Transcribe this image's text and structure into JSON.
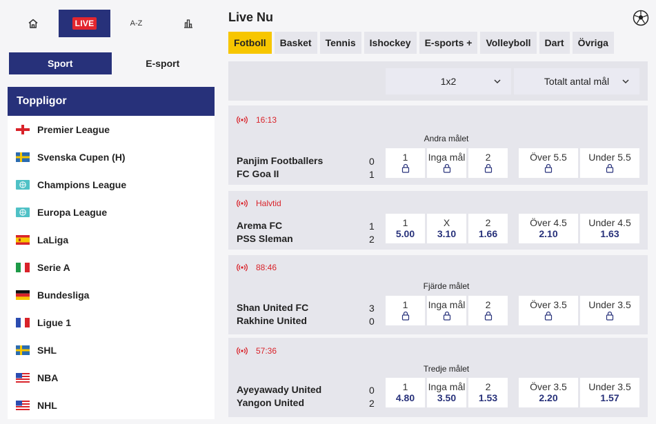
{
  "nav": {
    "home_icon": "home-icon",
    "live_label": "LIVE",
    "az_label": "A-Z",
    "stats_icon": "bar-chart-icon"
  },
  "segment": {
    "sport_label": "Sport",
    "esport_label": "E-sport"
  },
  "topleagues": {
    "title": "Toppligor",
    "items": [
      {
        "label": "Premier League",
        "flag": "england"
      },
      {
        "label": "Svenska Cupen (H)",
        "flag": "sweden"
      },
      {
        "label": "Champions League",
        "flag": "globe"
      },
      {
        "label": "Europa League",
        "flag": "globe"
      },
      {
        "label": "LaLiga",
        "flag": "spain"
      },
      {
        "label": "Serie A",
        "flag": "italy"
      },
      {
        "label": "Bundesliga",
        "flag": "germany"
      },
      {
        "label": "Ligue 1",
        "flag": "france"
      },
      {
        "label": "SHL",
        "flag": "sweden"
      },
      {
        "label": "NBA",
        "flag": "usa"
      },
      {
        "label": "NHL",
        "flag": "usa"
      }
    ]
  },
  "main": {
    "title": "Live Nu",
    "ball_icon": "soccer-ball-icon",
    "tabs": [
      "Fotboll",
      "Basket",
      "Tennis",
      "Ishockey",
      "E-sports +",
      "Volleyboll",
      "Dart",
      "Övriga"
    ],
    "active_tab": "Fotboll",
    "filters": {
      "market1": "1x2",
      "market2": "Totalt antal mål"
    }
  },
  "matches": [
    {
      "time": "16:13",
      "market_title": "Andra målet",
      "home": "Panjim Footballers",
      "away": "FC Goa II",
      "home_score": "0",
      "away_score": "1",
      "odds": [
        {
          "label": "1",
          "value": "",
          "locked": true
        },
        {
          "label": "Inga mål",
          "value": "",
          "locked": true
        },
        {
          "label": "2",
          "value": "",
          "locked": true
        },
        {
          "label": "Över 5.5",
          "value": "",
          "locked": true
        },
        {
          "label": "Under 5.5",
          "value": "",
          "locked": true
        }
      ]
    },
    {
      "time": "Halvtid",
      "market_title": "",
      "home": "Arema FC",
      "away": "PSS Sleman",
      "home_score": "1",
      "away_score": "2",
      "odds": [
        {
          "label": "1",
          "value": "5.00",
          "locked": false
        },
        {
          "label": "X",
          "value": "3.10",
          "locked": false
        },
        {
          "label": "2",
          "value": "1.66",
          "locked": false
        },
        {
          "label": "Över 4.5",
          "value": "2.10",
          "locked": false
        },
        {
          "label": "Under 4.5",
          "value": "1.63",
          "locked": false
        }
      ]
    },
    {
      "time": "88:46",
      "market_title": "Fjärde målet",
      "home": "Shan United FC",
      "away": "Rakhine United",
      "home_score": "3",
      "away_score": "0",
      "odds": [
        {
          "label": "1",
          "value": "",
          "locked": true
        },
        {
          "label": "Inga mål",
          "value": "",
          "locked": true
        },
        {
          "label": "2",
          "value": "",
          "locked": true
        },
        {
          "label": "Över 3.5",
          "value": "",
          "locked": true
        },
        {
          "label": "Under 3.5",
          "value": "",
          "locked": true
        }
      ]
    },
    {
      "time": "57:36",
      "market_title": "Tredje målet",
      "home": "Ayeyawady United",
      "away": "Yangon United",
      "home_score": "0",
      "away_score": "2",
      "odds": [
        {
          "label": "1",
          "value": "4.80",
          "locked": false
        },
        {
          "label": "Inga mål",
          "value": "3.50",
          "locked": false
        },
        {
          "label": "2",
          "value": "1.53",
          "locked": false
        },
        {
          "label": "Över 3.5",
          "value": "2.20",
          "locked": false
        },
        {
          "label": "Under 3.5",
          "value": "1.57",
          "locked": false
        }
      ]
    }
  ],
  "colors": {
    "brand": "#27317a",
    "accent": "#f7c600",
    "live": "#d9232a"
  }
}
